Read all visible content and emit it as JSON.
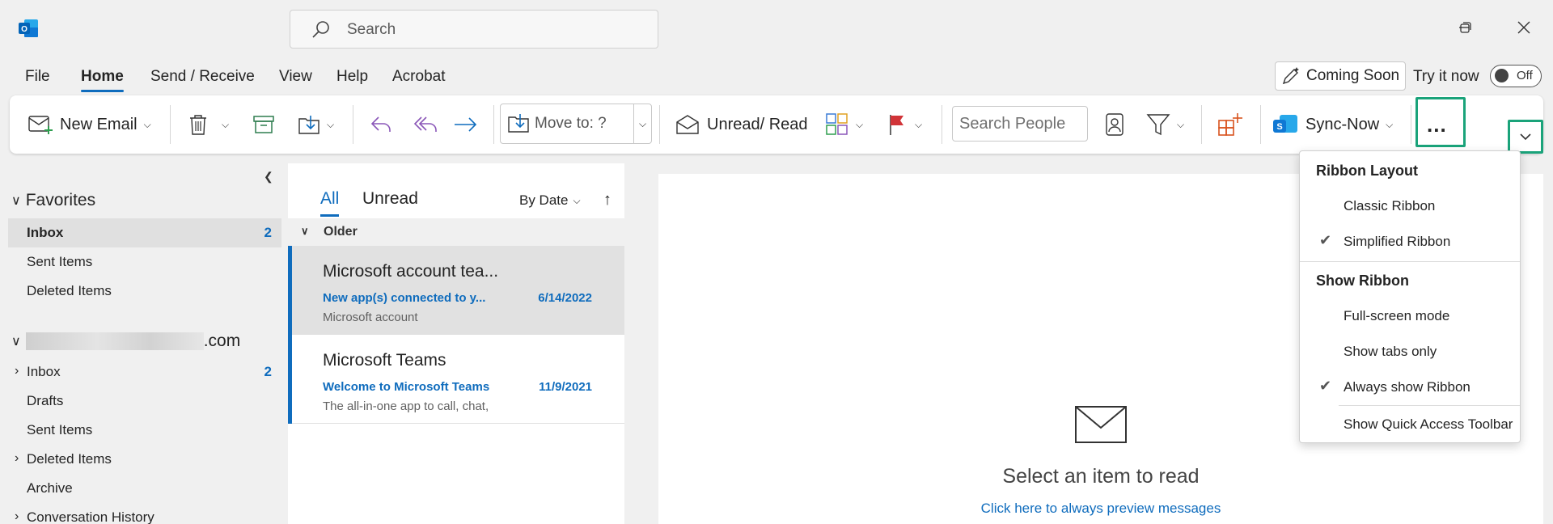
{
  "colors": {
    "accent": "#0f6cbd",
    "highlight": "#1aa37a"
  },
  "titlebar": {
    "search_placeholder": "Search",
    "logo_icon": "outlook-logo-icon",
    "window_controls": [
      "minimize-icon",
      "restore-icon",
      "close-icon"
    ]
  },
  "menu": {
    "items": [
      "File",
      "Home",
      "Send / Receive",
      "View",
      "Help",
      "Acrobat"
    ],
    "active": "Home",
    "coming_soon": "Coming Soon",
    "try_now": "Try it now",
    "toggle_label": "Off"
  },
  "ribbon": {
    "new_email": "New Email",
    "move_to": "Move to: ?",
    "unread_read": "Unread/ Read",
    "search_people_placeholder": "Search People",
    "sync_now": "Sync-Now",
    "more": "..."
  },
  "folders": {
    "favorites_label": "Favorites",
    "favorites": [
      {
        "name": "Inbox",
        "count": "2"
      },
      {
        "name": "Sent Items",
        "count": ""
      },
      {
        "name": "Deleted Items",
        "count": ""
      }
    ],
    "account_suffix": ".com",
    "account": [
      {
        "name": "Inbox",
        "count": "2"
      },
      {
        "name": "Drafts",
        "count": ""
      },
      {
        "name": "Sent Items",
        "count": ""
      },
      {
        "name": "Deleted Items",
        "count": ""
      },
      {
        "name": "Archive",
        "count": ""
      },
      {
        "name": "Conversation History",
        "count": ""
      }
    ]
  },
  "message_list": {
    "tab_all": "All",
    "tab_unread": "Unread",
    "sort_label": "By Date",
    "group_label": "Older",
    "messages": [
      {
        "sender": "Microsoft account tea...",
        "subject": "New app(s) connected to y...",
        "date": "6/14/2022",
        "preview": "Microsoft account"
      },
      {
        "sender": "Microsoft Teams",
        "subject": "Welcome to Microsoft Teams",
        "date": "11/9/2021",
        "preview": "The all-in-one app to call, chat,"
      }
    ]
  },
  "reading_pane": {
    "title": "Select an item to read",
    "link": "Click here to always preview messages"
  },
  "ribbon_dropdown": {
    "layout_header": "Ribbon Layout",
    "classic": "Classic Ribbon",
    "simplified": "Simplified Ribbon",
    "show_header": "Show Ribbon",
    "full_screen": "Full-screen mode",
    "tabs_only": "Show tabs only",
    "always_show": "Always show Ribbon",
    "quick_access": "Show Quick Access Toolbar"
  }
}
